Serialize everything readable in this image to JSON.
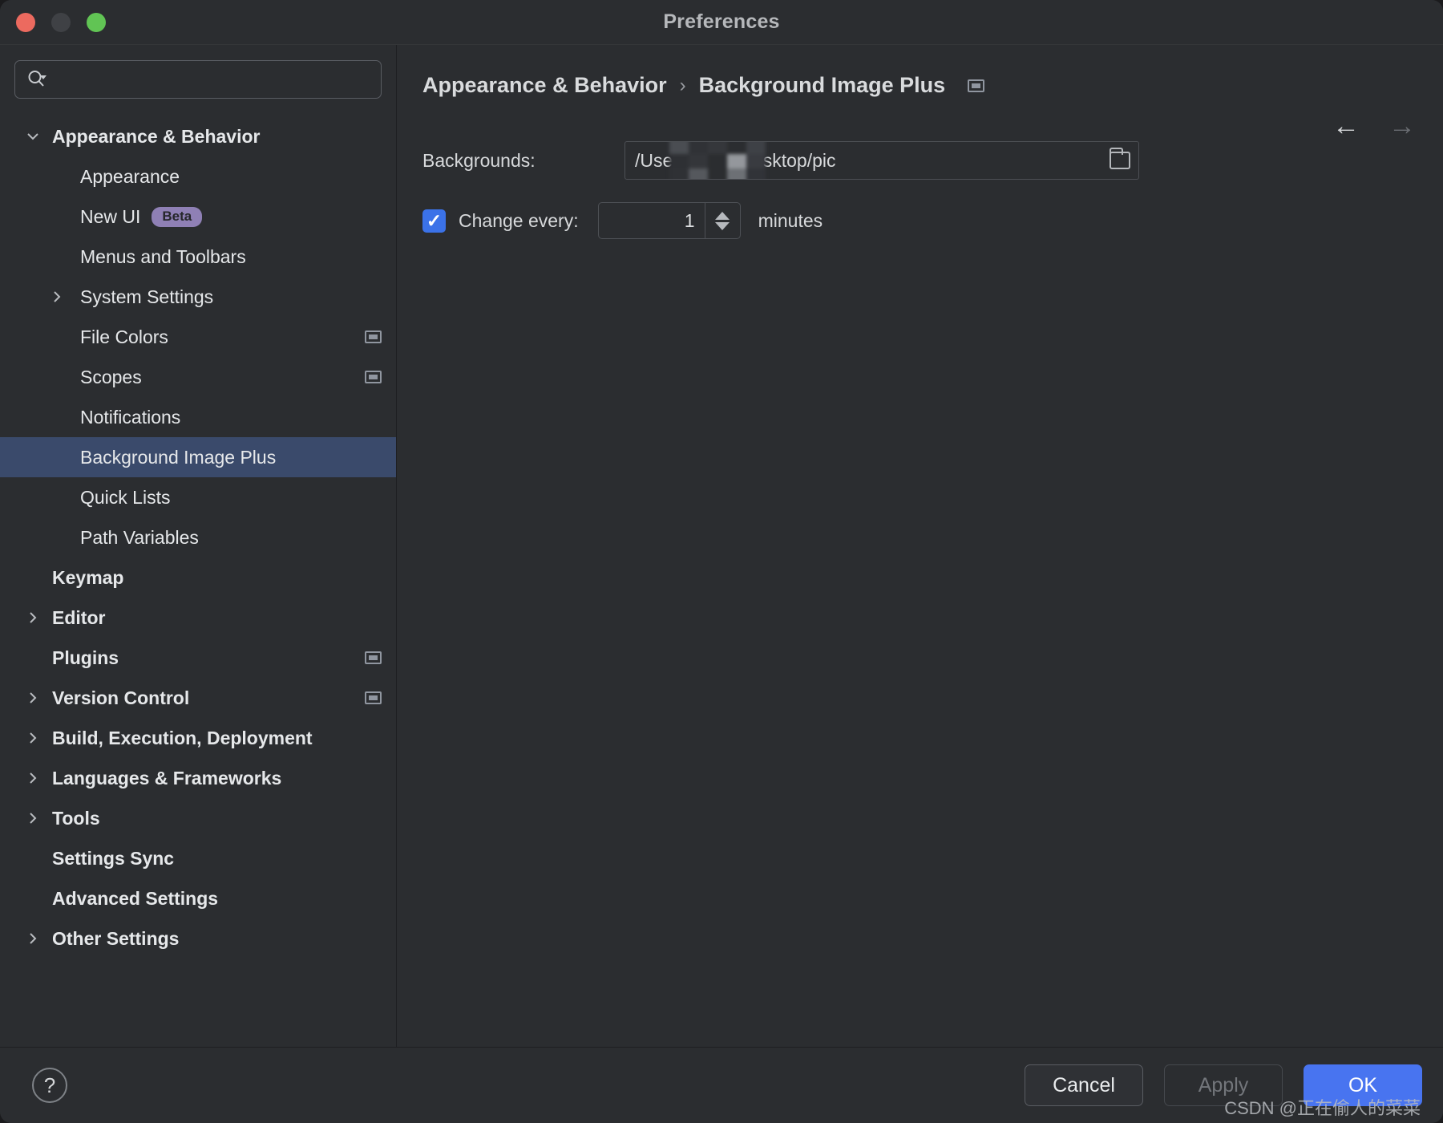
{
  "window": {
    "title": "Preferences",
    "traffic_lights": [
      "close-button",
      "minimize-button",
      "maximize-button"
    ],
    "colors": {
      "close": "#ec6a5f",
      "minimize": "#3f4145",
      "maximize": "#61c454",
      "background": "#2b2d30",
      "selection": "#3a4a6b",
      "accent": "#4874f0",
      "beta_badge": "#8f80b5"
    }
  },
  "search": {
    "placeholder": "",
    "value": "",
    "icon": "search-icon",
    "dropdown_icon": "chevron-down-icon"
  },
  "sidebar": {
    "items": [
      {
        "label": "Appearance & Behavior",
        "level": 0,
        "arrow": "chevron-down",
        "bold": true,
        "selected": false,
        "project_icon": false
      },
      {
        "label": "Appearance",
        "level": 1,
        "arrow": "none",
        "bold": false,
        "selected": false,
        "project_icon": false
      },
      {
        "label": "New UI",
        "level": 1,
        "arrow": "none",
        "bold": false,
        "selected": false,
        "project_icon": false,
        "badge": "Beta"
      },
      {
        "label": "Menus and Toolbars",
        "level": 1,
        "arrow": "none",
        "bold": false,
        "selected": false,
        "project_icon": false
      },
      {
        "label": "System Settings",
        "level": 1,
        "arrow": "chevron-right",
        "bold": false,
        "selected": false,
        "project_icon": false
      },
      {
        "label": "File Colors",
        "level": 1,
        "arrow": "none",
        "bold": false,
        "selected": false,
        "project_icon": true
      },
      {
        "label": "Scopes",
        "level": 1,
        "arrow": "none",
        "bold": false,
        "selected": false,
        "project_icon": true
      },
      {
        "label": "Notifications",
        "level": 1,
        "arrow": "none",
        "bold": false,
        "selected": false,
        "project_icon": false
      },
      {
        "label": "Background Image Plus",
        "level": 1,
        "arrow": "none",
        "bold": false,
        "selected": true,
        "project_icon": false
      },
      {
        "label": "Quick Lists",
        "level": 1,
        "arrow": "none",
        "bold": false,
        "selected": false,
        "project_icon": false
      },
      {
        "label": "Path Variables",
        "level": 1,
        "arrow": "none",
        "bold": false,
        "selected": false,
        "project_icon": false
      },
      {
        "label": "Keymap",
        "level": 0,
        "arrow": "none",
        "bold": true,
        "selected": false,
        "project_icon": false
      },
      {
        "label": "Editor",
        "level": 0,
        "arrow": "chevron-right",
        "bold": true,
        "selected": false,
        "project_icon": false
      },
      {
        "label": "Plugins",
        "level": 0,
        "arrow": "none",
        "bold": true,
        "selected": false,
        "project_icon": true
      },
      {
        "label": "Version Control",
        "level": 0,
        "arrow": "chevron-right",
        "bold": true,
        "selected": false,
        "project_icon": true
      },
      {
        "label": "Build, Execution, Deployment",
        "level": 0,
        "arrow": "chevron-right",
        "bold": true,
        "selected": false,
        "project_icon": false
      },
      {
        "label": "Languages & Frameworks",
        "level": 0,
        "arrow": "chevron-right",
        "bold": true,
        "selected": false,
        "project_icon": false
      },
      {
        "label": "Tools",
        "level": 0,
        "arrow": "chevron-right",
        "bold": true,
        "selected": false,
        "project_icon": false
      },
      {
        "label": "Settings Sync",
        "level": 0,
        "arrow": "none",
        "bold": true,
        "selected": false,
        "project_icon": false
      },
      {
        "label": "Advanced Settings",
        "level": 0,
        "arrow": "none",
        "bold": true,
        "selected": false,
        "project_icon": false
      },
      {
        "label": "Other Settings",
        "level": 0,
        "arrow": "chevron-right",
        "bold": true,
        "selected": false,
        "project_icon": false
      }
    ]
  },
  "main": {
    "breadcrumb": {
      "parent": "Appearance & Behavior",
      "separator": "›",
      "current": "Background Image Plus",
      "trailing_icon": "project-settings-icon"
    },
    "nav": {
      "back_icon": "arrow-left-icon",
      "back_glyph": "←",
      "back_enabled": true,
      "forward_icon": "arrow-right-icon",
      "forward_glyph": "→",
      "forward_enabled": false
    },
    "backgrounds": {
      "label": "Backgrounds:",
      "path_prefix": "/Users",
      "path_suffix": "/Desktop/pic",
      "redacted": true,
      "browse_icon": "folder-icon"
    },
    "change_every": {
      "checked": true,
      "check_glyph": "✓",
      "label": "Change every:",
      "value": "1",
      "unit_label": "minutes",
      "stepper_up_icon": "triangle-up-icon",
      "stepper_down_icon": "triangle-down-icon"
    }
  },
  "footer": {
    "help_icon": "question-mark-icon",
    "help_glyph": "?",
    "buttons": [
      {
        "label": "Cancel",
        "style": "normal",
        "name": "cancel-button",
        "enabled": true
      },
      {
        "label": "Apply",
        "style": "disabled",
        "name": "apply-button",
        "enabled": false
      },
      {
        "label": "OK",
        "style": "primary",
        "name": "ok-button",
        "enabled": true
      }
    ],
    "watermark": "CSDN @正在偷人的菜菜"
  }
}
